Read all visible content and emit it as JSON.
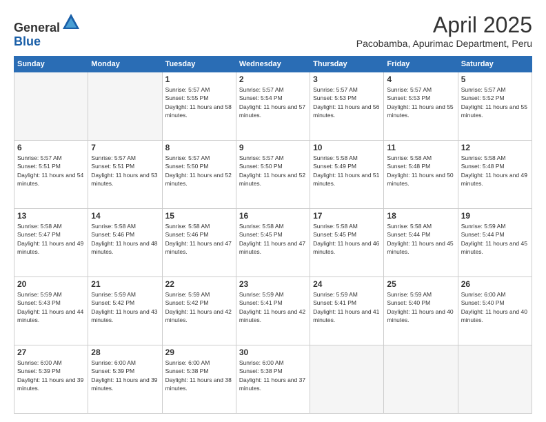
{
  "header": {
    "logo_general": "General",
    "logo_blue": "Blue",
    "month_year": "April 2025",
    "location": "Pacobamba, Apurimac Department, Peru"
  },
  "days_of_week": [
    "Sunday",
    "Monday",
    "Tuesday",
    "Wednesday",
    "Thursday",
    "Friday",
    "Saturday"
  ],
  "weeks": [
    [
      {
        "day": "",
        "empty": true
      },
      {
        "day": "",
        "empty": true
      },
      {
        "day": "1",
        "sunrise": "5:57 AM",
        "sunset": "5:55 PM",
        "daylight": "11 hours and 58 minutes."
      },
      {
        "day": "2",
        "sunrise": "5:57 AM",
        "sunset": "5:54 PM",
        "daylight": "11 hours and 57 minutes."
      },
      {
        "day": "3",
        "sunrise": "5:57 AM",
        "sunset": "5:53 PM",
        "daylight": "11 hours and 56 minutes."
      },
      {
        "day": "4",
        "sunrise": "5:57 AM",
        "sunset": "5:53 PM",
        "daylight": "11 hours and 55 minutes."
      },
      {
        "day": "5",
        "sunrise": "5:57 AM",
        "sunset": "5:52 PM",
        "daylight": "11 hours and 55 minutes."
      }
    ],
    [
      {
        "day": "6",
        "sunrise": "5:57 AM",
        "sunset": "5:51 PM",
        "daylight": "11 hours and 54 minutes."
      },
      {
        "day": "7",
        "sunrise": "5:57 AM",
        "sunset": "5:51 PM",
        "daylight": "11 hours and 53 minutes."
      },
      {
        "day": "8",
        "sunrise": "5:57 AM",
        "sunset": "5:50 PM",
        "daylight": "11 hours and 52 minutes."
      },
      {
        "day": "9",
        "sunrise": "5:57 AM",
        "sunset": "5:50 PM",
        "daylight": "11 hours and 52 minutes."
      },
      {
        "day": "10",
        "sunrise": "5:58 AM",
        "sunset": "5:49 PM",
        "daylight": "11 hours and 51 minutes."
      },
      {
        "day": "11",
        "sunrise": "5:58 AM",
        "sunset": "5:48 PM",
        "daylight": "11 hours and 50 minutes."
      },
      {
        "day": "12",
        "sunrise": "5:58 AM",
        "sunset": "5:48 PM",
        "daylight": "11 hours and 49 minutes."
      }
    ],
    [
      {
        "day": "13",
        "sunrise": "5:58 AM",
        "sunset": "5:47 PM",
        "daylight": "11 hours and 49 minutes."
      },
      {
        "day": "14",
        "sunrise": "5:58 AM",
        "sunset": "5:46 PM",
        "daylight": "11 hours and 48 minutes."
      },
      {
        "day": "15",
        "sunrise": "5:58 AM",
        "sunset": "5:46 PM",
        "daylight": "11 hours and 47 minutes."
      },
      {
        "day": "16",
        "sunrise": "5:58 AM",
        "sunset": "5:45 PM",
        "daylight": "11 hours and 47 minutes."
      },
      {
        "day": "17",
        "sunrise": "5:58 AM",
        "sunset": "5:45 PM",
        "daylight": "11 hours and 46 minutes."
      },
      {
        "day": "18",
        "sunrise": "5:58 AM",
        "sunset": "5:44 PM",
        "daylight": "11 hours and 45 minutes."
      },
      {
        "day": "19",
        "sunrise": "5:59 AM",
        "sunset": "5:44 PM",
        "daylight": "11 hours and 45 minutes."
      }
    ],
    [
      {
        "day": "20",
        "sunrise": "5:59 AM",
        "sunset": "5:43 PM",
        "daylight": "11 hours and 44 minutes."
      },
      {
        "day": "21",
        "sunrise": "5:59 AM",
        "sunset": "5:42 PM",
        "daylight": "11 hours and 43 minutes."
      },
      {
        "day": "22",
        "sunrise": "5:59 AM",
        "sunset": "5:42 PM",
        "daylight": "11 hours and 42 minutes."
      },
      {
        "day": "23",
        "sunrise": "5:59 AM",
        "sunset": "5:41 PM",
        "daylight": "11 hours and 42 minutes."
      },
      {
        "day": "24",
        "sunrise": "5:59 AM",
        "sunset": "5:41 PM",
        "daylight": "11 hours and 41 minutes."
      },
      {
        "day": "25",
        "sunrise": "5:59 AM",
        "sunset": "5:40 PM",
        "daylight": "11 hours and 40 minutes."
      },
      {
        "day": "26",
        "sunrise": "6:00 AM",
        "sunset": "5:40 PM",
        "daylight": "11 hours and 40 minutes."
      }
    ],
    [
      {
        "day": "27",
        "sunrise": "6:00 AM",
        "sunset": "5:39 PM",
        "daylight": "11 hours and 39 minutes."
      },
      {
        "day": "28",
        "sunrise": "6:00 AM",
        "sunset": "5:39 PM",
        "daylight": "11 hours and 39 minutes."
      },
      {
        "day": "29",
        "sunrise": "6:00 AM",
        "sunset": "5:38 PM",
        "daylight": "11 hours and 38 minutes."
      },
      {
        "day": "30",
        "sunrise": "6:00 AM",
        "sunset": "5:38 PM",
        "daylight": "11 hours and 37 minutes."
      },
      {
        "day": "",
        "empty": true
      },
      {
        "day": "",
        "empty": true
      },
      {
        "day": "",
        "empty": true
      }
    ]
  ],
  "labels": {
    "sunrise": "Sunrise:",
    "sunset": "Sunset:",
    "daylight": "Daylight:"
  }
}
